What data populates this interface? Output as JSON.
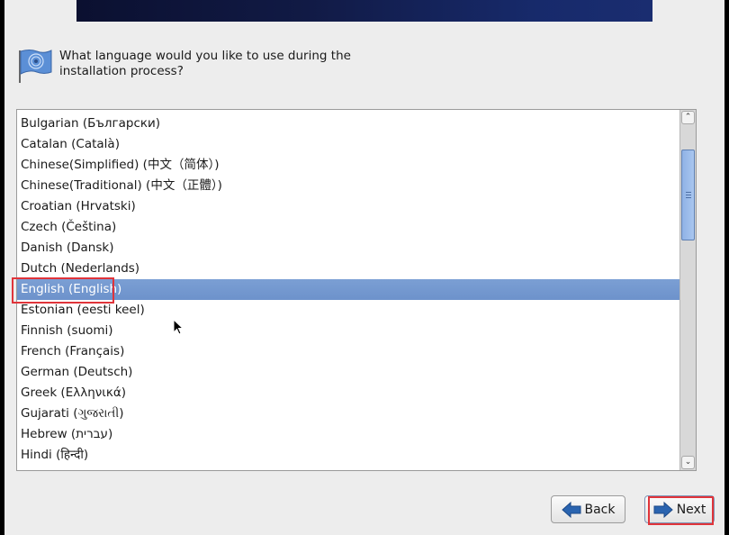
{
  "header": {
    "question": "What language would you like to use during the installation process?"
  },
  "languages": [
    {
      "label": "Bulgarian (Български)",
      "selected": false
    },
    {
      "label": "Catalan (Català)",
      "selected": false
    },
    {
      "label": "Chinese(Simplified) (中文（简体）)",
      "selected": false
    },
    {
      "label": "Chinese(Traditional) (中文（正體）)",
      "selected": false
    },
    {
      "label": "Croatian (Hrvatski)",
      "selected": false
    },
    {
      "label": "Czech (Čeština)",
      "selected": false
    },
    {
      "label": "Danish (Dansk)",
      "selected": false
    },
    {
      "label": "Dutch (Nederlands)",
      "selected": false
    },
    {
      "label": "English (English)",
      "selected": true
    },
    {
      "label": "Estonian (eesti keel)",
      "selected": false
    },
    {
      "label": "Finnish (suomi)",
      "selected": false
    },
    {
      "label": "French (Français)",
      "selected": false
    },
    {
      "label": "German (Deutsch)",
      "selected": false
    },
    {
      "label": "Greek (Ελληνικά)",
      "selected": false
    },
    {
      "label": "Gujarati (ગુજરાતી)",
      "selected": false
    },
    {
      "label": "Hebrew (עברית)",
      "selected": false
    },
    {
      "label": "Hindi (हिन्दी)",
      "selected": false
    }
  ],
  "buttons": {
    "back": "Back",
    "next": "Next"
  },
  "colors": {
    "selection": "#7097ce",
    "highlight_box": "#e0343a",
    "arrow_blue": "#2a64b0"
  }
}
